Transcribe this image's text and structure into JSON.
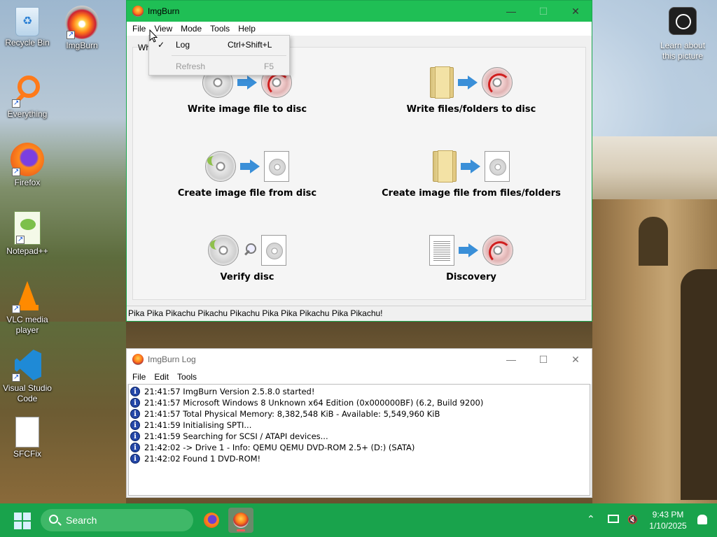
{
  "desktop": {
    "icons": [
      {
        "label": "Recycle Bin"
      },
      {
        "label": "ImgBurn"
      },
      {
        "label": "Everything"
      },
      {
        "label": "Firefox"
      },
      {
        "label": "Notepad++"
      },
      {
        "label": "VLC media player"
      },
      {
        "label": "Visual Studio Code"
      },
      {
        "label": "SFCFix"
      }
    ],
    "learn_label": "Learn about this picture"
  },
  "main_window": {
    "title": "ImgBurn",
    "menu": [
      "File",
      "View",
      "Mode",
      "Tools",
      "Help"
    ],
    "tab_fragment": "Wh",
    "actions": [
      {
        "label": "Write image file to disc"
      },
      {
        "label": "Write files/folders to disc"
      },
      {
        "label": "Create image file from disc"
      },
      {
        "label": "Create image file from files/folders"
      },
      {
        "label": "Verify disc"
      },
      {
        "label": "Discovery"
      }
    ],
    "status": "Pika Pika Pikachu Pikachu Pikachu Pika Pika Pikachu Pika Pikachu!"
  },
  "view_menu": {
    "items": [
      {
        "check": "✓",
        "label": "Log",
        "shortcut": "Ctrl+Shift+L",
        "enabled": true
      },
      {
        "check": "",
        "label": "Refresh",
        "shortcut": "F5",
        "enabled": false
      }
    ]
  },
  "log_window": {
    "title": "ImgBurn Log",
    "menu": [
      "File",
      "Edit",
      "Tools"
    ],
    "lines": [
      "21:41:57 ImgBurn Version 2.5.8.0 started!",
      "21:41:57 Microsoft Windows 8 Unknown x64 Edition (0x000000BF) (6.2, Build 9200)",
      "21:41:57 Total Physical Memory: 8,382,548 KiB  -  Available: 5,549,960 KiB",
      "21:41:59 Initialising SPTI...",
      "21:41:59 Searching for SCSI / ATAPI devices...",
      "21:42:02 -> Drive 1 - Info: QEMU QEMU DVD-ROM 2.5+ (D:) (SATA)",
      "21:42:02 Found 1 DVD-ROM!"
    ]
  },
  "taskbar": {
    "search_placeholder": "Search",
    "time": "9:43 PM",
    "date": "1/10/2025"
  },
  "colors": {
    "accent": "#1fbf55",
    "taskbar": "#19a34c"
  }
}
